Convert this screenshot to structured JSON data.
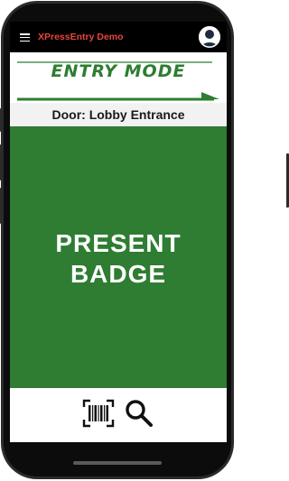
{
  "app_bar": {
    "title": "XPressEntry Demo",
    "menu_icon": "hamburger-menu-icon",
    "avatar_icon": "user-avatar-icon"
  },
  "mode_banner": {
    "label": "ENTRY MODE"
  },
  "door": {
    "label": "Door: Lobby Entrance"
  },
  "prompt": {
    "line1": "PRESENT",
    "line2": "BADGE"
  },
  "actions": {
    "barcode_icon": "barcode-scan-icon",
    "search_icon": "search-icon"
  },
  "colors": {
    "accent_green": "#2e7d32",
    "title_red": "#e8453c",
    "app_bar": "#000000"
  }
}
